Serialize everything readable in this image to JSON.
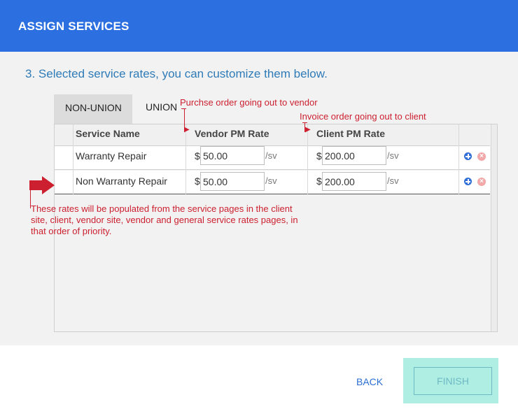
{
  "header": {
    "title": "ASSIGN SERVICES"
  },
  "step": {
    "title": "3. Selected service rates, you can customize them below."
  },
  "tabs": [
    {
      "label": "NON-UNION",
      "active": true
    },
    {
      "label": "UNION",
      "active": false
    }
  ],
  "table": {
    "columns": [
      "Service Name",
      "Vendor PM Rate",
      "Client PM Rate"
    ],
    "currency": "$",
    "unit": "/sv",
    "rows": [
      {
        "service": "Warranty Repair",
        "vendor_rate": "50.00",
        "client_rate": "200.00"
      },
      {
        "service": "Non Warranty Repair",
        "vendor_rate": "50.00",
        "client_rate": "200.00"
      }
    ]
  },
  "annotations": {
    "vendor_note": "Purchse order going out to vendor",
    "client_note": "Invoice order going out to client",
    "priority_note": [
      "These rates will be populated from the service pages in the client",
      "site, client, vendor site, vendor and general service rates pages, in",
      "that order of priority."
    ]
  },
  "footer": {
    "back_label": "BACK",
    "finish_label": "FINISH"
  },
  "colors": {
    "header": "#2b6fe0",
    "annotation": "#cc1f2f",
    "finish_highlight": "#aeeee3",
    "link": "#2b6fd6"
  },
  "icons": [
    "plus-circle-icon",
    "remove-circle-icon",
    "arrow-right-icon"
  ]
}
